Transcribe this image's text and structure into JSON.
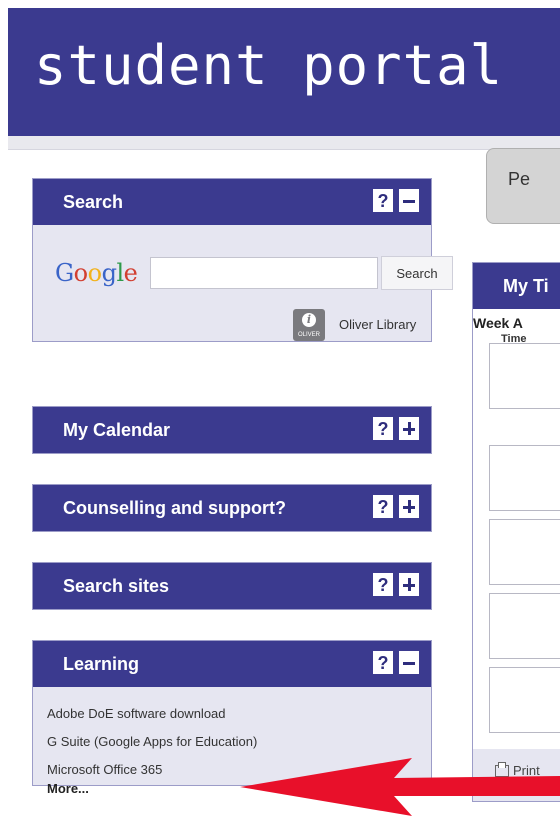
{
  "header": {
    "title": "student portal"
  },
  "panels": {
    "search": {
      "title": "Search",
      "help_label": "?",
      "google_logo": [
        "G",
        "o",
        "o",
        "g",
        "l",
        "e"
      ],
      "input_value": "",
      "search_button": "Search",
      "oliver_icon_text": "OLIVER",
      "oliver_label": "Oliver Library"
    },
    "calendar": {
      "title": "My Calendar",
      "help_label": "?"
    },
    "counselling": {
      "title": "Counselling and support?",
      "help_label": "?"
    },
    "search_sites": {
      "title": "Search sites",
      "help_label": "?"
    },
    "learning": {
      "title": "Learning",
      "help_label": "?",
      "links": [
        "Adobe DoE software download",
        "G Suite (Google Apps for Education)",
        "Microsoft Office 365"
      ],
      "more": "More..."
    }
  },
  "right": {
    "tab_label": "Pe",
    "timetable_title": "My Ti",
    "week_label": "Week A",
    "time_label": "Time",
    "print_label": "Print"
  },
  "colors": {
    "brand": "#3b3a8f",
    "panel_bg": "#e6e6f1",
    "annotation_arrow": "#e8102a"
  }
}
